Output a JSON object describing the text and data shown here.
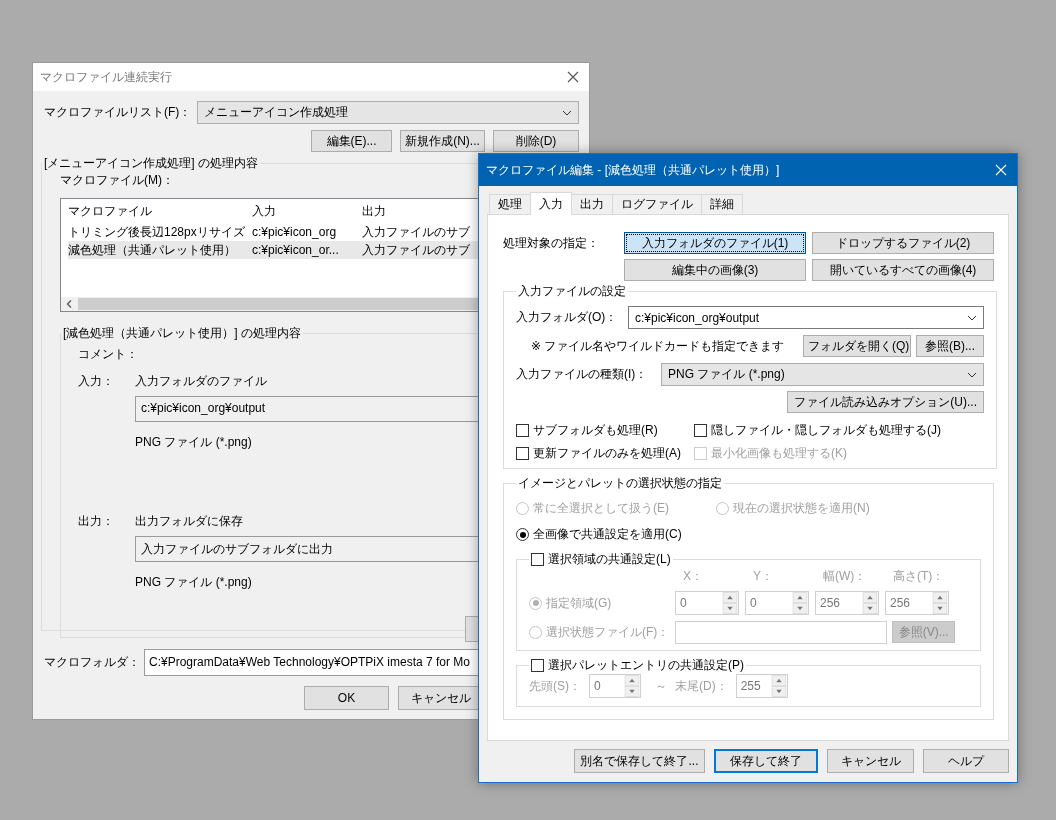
{
  "back_window": {
    "title": "マクロファイル連続実行",
    "macro_list_label": "マクロファイルリスト(F)：",
    "macro_list_value": "メニューアイコン作成処理",
    "buttons": [
      "編集(E)...",
      "新規作成(N)...",
      "削除(D)"
    ],
    "group_title": "[メニューアイコン作成処理] の処理内容",
    "macro_files_label": "マクロファイル(M)：",
    "table": {
      "columns": [
        "マクロファイル",
        "入力",
        "出力"
      ],
      "rows": [
        {
          "cells": [
            "トリミング後長辺128pxリサイズ",
            "c:¥pic¥icon_org",
            "入力ファイルのサブ"
          ],
          "selected": false
        },
        {
          "cells": [
            "減色処理（共通パレット使用）",
            "c:¥pic¥icon_or...",
            "入力ファイルのサブ"
          ],
          "selected": true
        }
      ]
    },
    "detail": {
      "title": "[減色処理（共通パレット使用）] の処理内容",
      "comment_label": "コメント：",
      "input_label": "入力：",
      "input_mode": "入力フォルダのファイル",
      "input_path": "c:¥pic¥icon_org¥output",
      "input_type": "PNG ファイル (*.png)",
      "output_label": "出力：",
      "output_mode": "出力フォルダに保存",
      "output_path": "入力ファイルのサブフォルダに出力",
      "output_type": "PNG ファイル (*.png)"
    },
    "macro_folder_label": "マクロフォルダ：",
    "macro_folder_path": "C:¥ProgramData¥Web Technology¥OPTPiX imesta 7 for Mo",
    "footer_buttons": [
      "OK",
      "キャンセル"
    ]
  },
  "dialog": {
    "title": "マクロファイル編集 - [減色処理（共通パレット使用）]",
    "tabs": [
      {
        "label": "処理",
        "selected": false
      },
      {
        "label": "入力",
        "selected": true
      },
      {
        "label": "出力",
        "selected": false
      },
      {
        "label": "ログファイル",
        "selected": false
      },
      {
        "label": "詳細",
        "selected": false
      }
    ],
    "target_label": "処理対象の指定：",
    "target_buttons": [
      {
        "label": "入力フォルダのファイル(1)",
        "selected": true
      },
      {
        "label": "ドロップするファイル(2)",
        "selected": false
      },
      {
        "label": "編集中の画像(3)",
        "selected": false
      },
      {
        "label": "開いているすべての画像(4)",
        "selected": false
      }
    ],
    "input_group": {
      "title": "入力ファイルの設定",
      "folder_label": "入力フォルダ(O)：",
      "folder_value": "c:¥pic¥icon_org¥output",
      "hint": "※ ファイル名やワイルドカードも指定できます",
      "open_folder_button": "フォルダを開く(Q)",
      "browse_button": "参照(B)...",
      "type_label": "入力ファイルの種類(I)：",
      "type_value": "PNG ファイル (*.png)",
      "options_button": "ファイル読み込みオプション(U)...",
      "checkboxes": [
        {
          "label": "サブフォルダも処理(R)",
          "checked": false,
          "disabled": false
        },
        {
          "label": "隠しファイル・隠しフォルダも処理する(J)",
          "checked": false,
          "disabled": false
        },
        {
          "label": "更新ファイルのみを処理(A)",
          "checked": false,
          "disabled": false
        },
        {
          "label": "最小化画像も処理する(K)",
          "checked": false,
          "disabled": true
        }
      ]
    },
    "selection_group": {
      "title": "イメージとパレットの選択状態の指定",
      "radios": [
        {
          "label": "常に全選択として扱う(E)",
          "selected": false,
          "disabled": true
        },
        {
          "label": "現在の選択状態を適用(N)",
          "selected": false,
          "disabled": true
        },
        {
          "label": "全画像で共通設定を適用(C)",
          "selected": true,
          "disabled": false
        }
      ],
      "region": {
        "label": "選択領域の共通設定(L)",
        "checked": false,
        "radios": [
          {
            "label": "指定領域(G)",
            "selected": true,
            "disabled": true
          },
          {
            "label": "選択状態ファイル(F)：",
            "selected": false,
            "disabled": true
          }
        ],
        "spins": [
          {
            "label": "X：",
            "value": "0"
          },
          {
            "label": "Y：",
            "value": "0"
          },
          {
            "label": "幅(W)：",
            "value": "256"
          },
          {
            "label": "高さ(T)：",
            "value": "256"
          }
        ],
        "browse_button": "参照(V)..."
      },
      "palette": {
        "label": "選択パレットエントリの共通設定(P)",
        "checked": false,
        "start_label": "先頭(S)：",
        "start_value": "0",
        "separator": "～",
        "end_label": "末尾(D)：",
        "end_value": "255"
      }
    },
    "footer_buttons": [
      {
        "label": "別名で保存して終了...",
        "default": false
      },
      {
        "label": "保存して終了",
        "default": true
      },
      {
        "label": "キャンセル",
        "default": false
      },
      {
        "label": "ヘルプ",
        "default": false
      }
    ]
  }
}
